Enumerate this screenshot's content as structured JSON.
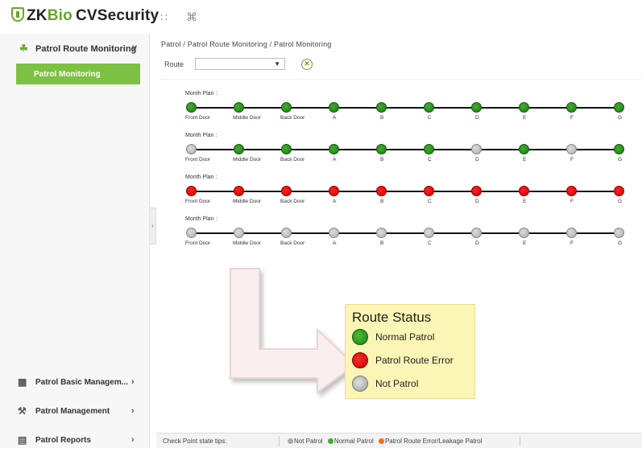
{
  "app": {
    "logo_zk": "ZK",
    "logo_bio": "Bio",
    "logo_cv": "CVSecurity",
    "grid_icon": "grid-icon",
    "command_icon": "command-icon"
  },
  "sidebar": {
    "section": {
      "label": "Patrol Route Monitoring",
      "icon": "patrol-route-icon"
    },
    "active_item": "Patrol Monitoring",
    "bottom_items": [
      {
        "label": "Patrol Basic Managem...",
        "icon": "building-icon"
      },
      {
        "label": "Patrol Management",
        "icon": "wrench-icon"
      },
      {
        "label": "Patrol Reports",
        "icon": "report-icon"
      }
    ]
  },
  "main": {
    "breadcrumb": "Patrol / Patrol Route Monitoring / Patrol Monitoring",
    "route_label": "Route",
    "route_value": "",
    "plans": [
      {
        "label": "Month Plan :",
        "statuses": [
          "green",
          "green",
          "green",
          "green",
          "green",
          "green",
          "green",
          "green",
          "green",
          "green"
        ]
      },
      {
        "label": "Month Plan :",
        "statuses": [
          "gray",
          "green",
          "green",
          "green",
          "green",
          "green",
          "gray",
          "green",
          "gray",
          "green"
        ]
      },
      {
        "label": "Month Plan :",
        "statuses": [
          "red",
          "red",
          "red",
          "red",
          "red",
          "red",
          "red",
          "red",
          "red",
          "red"
        ]
      },
      {
        "label": "Month Plan :",
        "statuses": [
          "gray",
          "gray",
          "gray",
          "gray",
          "gray",
          "gray",
          "gray",
          "gray",
          "gray",
          "gray"
        ]
      }
    ],
    "checkpoints": [
      "Front Door",
      "Middle Door",
      "Back Door",
      "A",
      "B",
      "C",
      "D",
      "E",
      "F",
      "G"
    ]
  },
  "statusbar": {
    "tips_label": "Check Point state tips:",
    "legend": [
      {
        "label": "Not Patrol",
        "color": "#aaaaaa"
      },
      {
        "label": "Normal Patrol",
        "color": "#3fae2e"
      },
      {
        "label": "Patrol Route Error/Leakage Patrol",
        "color": "#ff6a1a"
      }
    ]
  },
  "callout": {
    "title": "Route Status",
    "items": [
      {
        "label": "Normal Patrol",
        "color": "#2e9a22"
      },
      {
        "label": "Patrol Route Error",
        "color": "#e00000"
      },
      {
        "label": "Not Patrol",
        "color": "#b0b0b0"
      }
    ]
  },
  "colors": {
    "accent": "#7dc142",
    "normal": "#3fae2e",
    "error": "#e00000",
    "not_patrol": "#aaaaaa"
  }
}
